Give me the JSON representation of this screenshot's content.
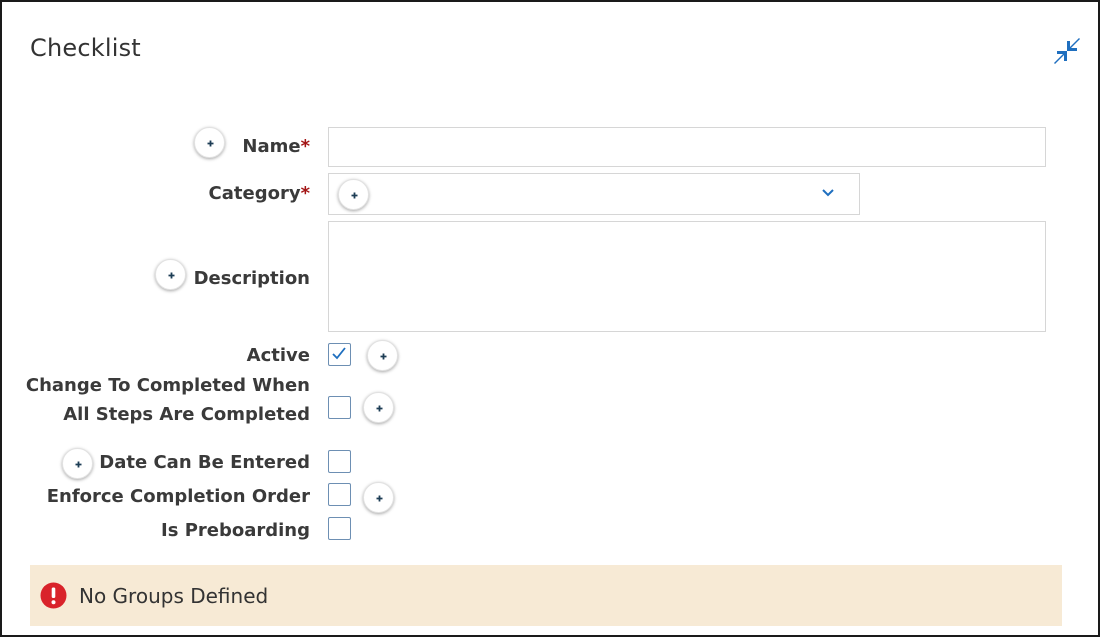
{
  "panel": {
    "title": "Checklist",
    "collapse_icon": "collapse-arrows-icon",
    "accent_color": "#1f6fbf"
  },
  "fields": {
    "name": {
      "label": "Name",
      "required_mark": "*",
      "value": ""
    },
    "category": {
      "label": "Category",
      "required_mark": "*",
      "selected": ""
    },
    "description": {
      "label": "Description",
      "value": ""
    },
    "active": {
      "label": "Active",
      "checked": true
    },
    "change_to_completed": {
      "label_line1": "Change To Completed When",
      "label_line2": "All Steps Are Completed",
      "checked": false
    },
    "date_can_be_entered": {
      "label": "Date Can Be Entered",
      "checked": false
    },
    "enforce_completion_order": {
      "label": "Enforce Completion Order",
      "checked": false
    },
    "is_preboarding": {
      "label": "Is Preboarding",
      "checked": false
    }
  },
  "notice": {
    "text": "No Groups Defined",
    "icon": "error-exclamation-icon",
    "bg_color": "#f7ead5",
    "icon_color": "#d9232a"
  }
}
